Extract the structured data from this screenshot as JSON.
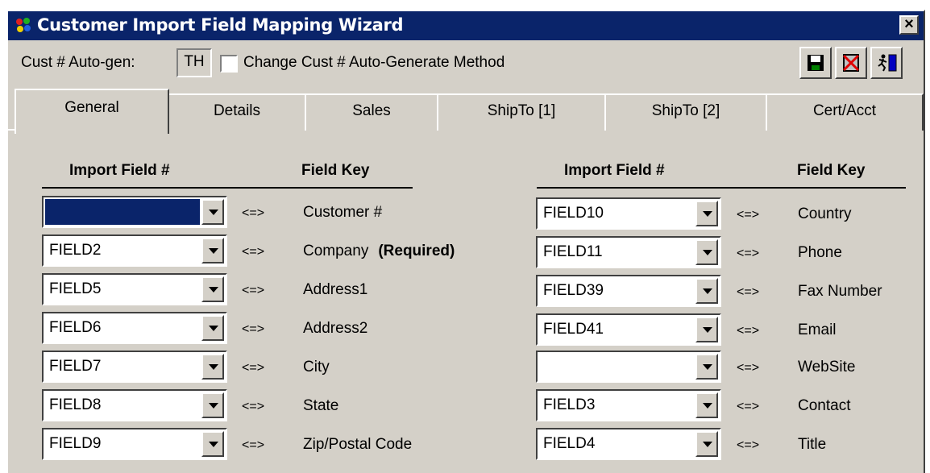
{
  "window": {
    "title": "Customer Import Field Mapping Wizard",
    "close_label": "×"
  },
  "toolbar": {
    "autogen_label": "Cust # Auto-gen:",
    "autogen_value": "TH",
    "change_method_label": "Change Cust # Auto-Generate Method",
    "change_method_checked": false,
    "buttons": [
      {
        "icon": "save-icon"
      },
      {
        "icon": "cancel-icon"
      },
      {
        "icon": "exit-icon"
      }
    ]
  },
  "tabs": [
    {
      "label": "General",
      "active": true
    },
    {
      "label": "Details",
      "active": false
    },
    {
      "label": "Sales",
      "active": false
    },
    {
      "label": "ShipTo [1]",
      "active": false
    },
    {
      "label": "ShipTo [2]",
      "active": false
    },
    {
      "label": "Cert/Acct",
      "active": false
    }
  ],
  "headers": {
    "import_field": "Import Field #",
    "field_key": "Field Key"
  },
  "arrow_text": "<=>",
  "required_text": "(Required)",
  "left_rows": [
    {
      "value": "",
      "key": "Customer #"
    },
    {
      "value": "FIELD2",
      "key": "Company"
    },
    {
      "value": "FIELD5",
      "key": "Address1"
    },
    {
      "value": "FIELD6",
      "key": "Address2"
    },
    {
      "value": "FIELD7",
      "key": "City"
    },
    {
      "value": "FIELD8",
      "key": "State"
    },
    {
      "value": "FIELD9",
      "key": "Zip/Postal Code"
    }
  ],
  "right_rows": [
    {
      "value": "FIELD10",
      "key": "Country"
    },
    {
      "value": "FIELD11",
      "key": "Phone"
    },
    {
      "value": "FIELD39",
      "key": "Fax Number"
    },
    {
      "value": "FIELD41",
      "key": "Email"
    },
    {
      "value": "",
      "key": "WebSite"
    },
    {
      "value": "FIELD3",
      "key": "Contact"
    },
    {
      "value": "FIELD4",
      "key": "Title"
    }
  ],
  "colors": {
    "titlebar": "#0a246a",
    "face": "#d4d0c8",
    "selection": "#0a246a"
  }
}
